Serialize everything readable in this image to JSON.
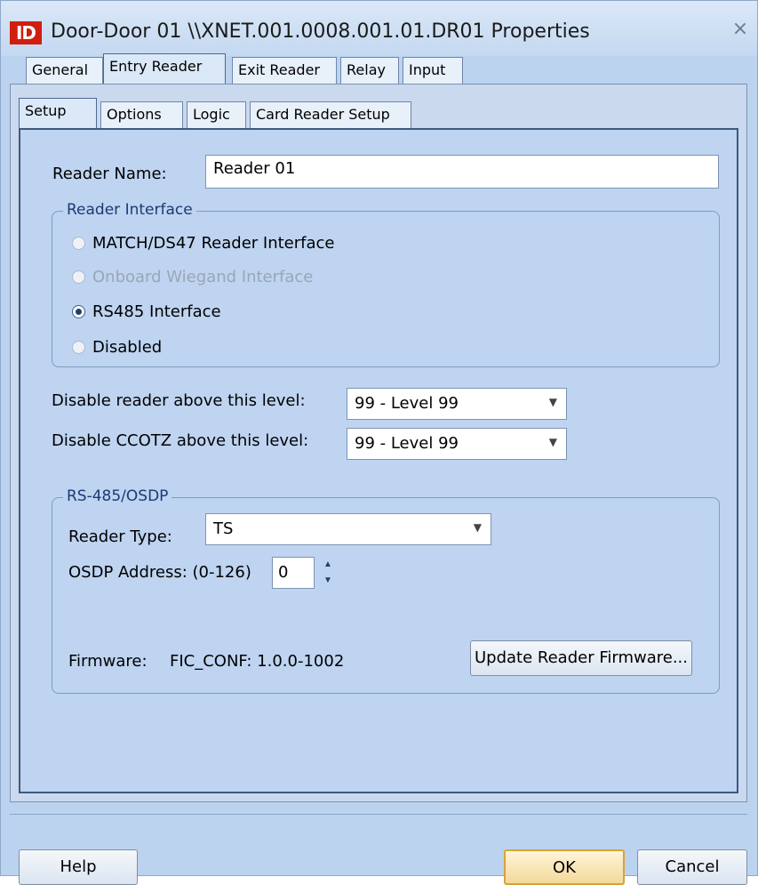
{
  "window": {
    "title": "Door-Door 01 \\\\XNET.001.0008.001.01.DR01 Properties",
    "app_icon_text": "ID",
    "close_glyph": "×"
  },
  "main_tabs": [
    {
      "label": "General",
      "underline": "G",
      "rest": "eneral",
      "active": false
    },
    {
      "label": "Entry Reader",
      "underline": "E",
      "rest": "ntry Reader",
      "active": true
    },
    {
      "label": "Exit Reader",
      "underline": "x",
      "rest": "it Reader",
      "active": false
    },
    {
      "label": "Relay",
      "underline": "R",
      "rest": "elay",
      "active": false
    },
    {
      "label": "Input",
      "underline": "I",
      "rest": "nput",
      "active": false
    }
  ],
  "sub_tabs": [
    {
      "label": "Setup",
      "active": true
    },
    {
      "label": "Options",
      "active": false
    },
    {
      "label": "Logic",
      "active": false
    },
    {
      "label": "Card Reader Setup",
      "active": false
    }
  ],
  "setup": {
    "reader_name_label": "Reader Name:",
    "reader_name_value": "Reader 01",
    "reader_interface": {
      "title": "Reader Interface",
      "options": [
        {
          "label": "MATCH/DS47 Reader Interface",
          "selected": false,
          "enabled": true
        },
        {
          "label": "Onboard Wiegand Interface",
          "selected": false,
          "enabled": false
        },
        {
          "label": "RS485 Interface",
          "selected": true,
          "enabled": true
        },
        {
          "label": "Disabled",
          "selected": false,
          "enabled": true
        }
      ]
    },
    "disable_reader_label": "Disable reader above this level:",
    "disable_reader_value": "99 - Level 99",
    "disable_ccotz_label": "Disable CCOTZ above this level:",
    "disable_ccotz_value": "99 - Level 99",
    "rs485": {
      "title": "RS-485/OSDP",
      "reader_type_label": "Reader Type:",
      "reader_type_value": "TS",
      "osdp_address_label": "OSDP Address: (0-126)",
      "osdp_address_value": "0",
      "firmware_label": "Firmware:",
      "firmware_value": "FIC_CONF: 1.0.0-1002",
      "update_button": "Update Reader Firmware..."
    }
  },
  "footer": {
    "help_button": "Help",
    "ok_button": "OK",
    "cancel_button": "Cancel"
  },
  "colors": {
    "window_bg": "#bcd3ef",
    "group_title": "#1c3a73",
    "default_button_border": "#d7a33a"
  }
}
